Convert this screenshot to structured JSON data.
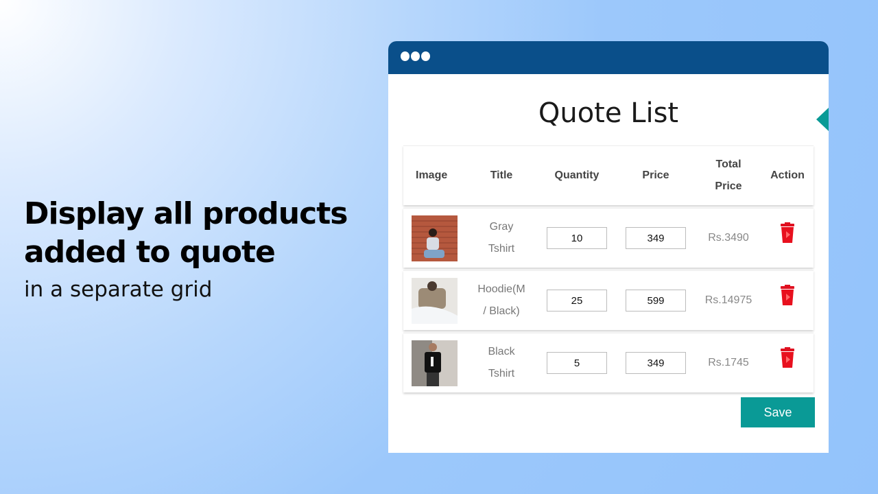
{
  "hero": {
    "title_line1": "Display all products",
    "title_line2": "added to quote",
    "subtitle": "in a separate grid"
  },
  "window": {
    "title": "Quote List",
    "accent_color": "#0a4f8a",
    "button_color": "#0a9a96"
  },
  "table": {
    "headers": {
      "image": "Image",
      "title": "Title",
      "quantity": "Quantity",
      "price": "Price",
      "total_line1": "Total",
      "total_line2": "Price",
      "action": "Action"
    },
    "rows": [
      {
        "title_line1": "Gray",
        "title_line2": "Tshirt",
        "quantity": "10",
        "price": "349",
        "total": "Rs.3490",
        "image_icon": "gray-tshirt-photo"
      },
      {
        "title_line1": "Hoodie(M",
        "title_line2": "/ Black)",
        "quantity": "25",
        "price": "599",
        "total": "Rs.14975",
        "image_icon": "hoodie-photo"
      },
      {
        "title_line1": "Black",
        "title_line2": "Tshirt",
        "quantity": "5",
        "price": "349",
        "total": "Rs.1745",
        "image_icon": "black-tshirt-photo"
      }
    ]
  },
  "actions": {
    "save_label": "Save",
    "delete_icon": "trash-icon"
  }
}
